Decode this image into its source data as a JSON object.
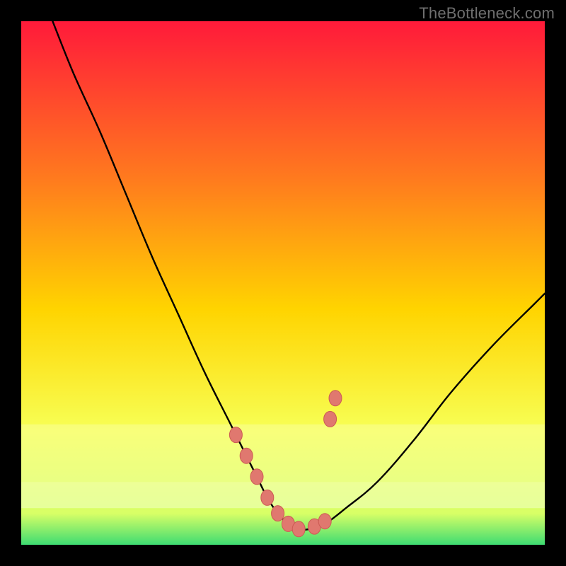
{
  "watermark": "TheBottleneck.com",
  "colors": {
    "bg_black": "#000000",
    "grad_top": "#ff1a3a",
    "grad_mid1": "#ff7a1e",
    "grad_mid2": "#ffd400",
    "grad_mid3": "#f7ff55",
    "grad_mid4": "#d8ff66",
    "grad_bottom": "#3edc72",
    "curve": "#000000",
    "marker_fill": "#e0786f",
    "marker_stroke": "#cc5b54",
    "watermark": "#6f6f6f"
  },
  "chart_data": {
    "type": "line",
    "title": "",
    "xlabel": "",
    "ylabel": "",
    "xlim": [
      0,
      100
    ],
    "ylim": [
      0,
      100
    ],
    "series": [
      {
        "name": "bottleneck-curve",
        "x": [
          6,
          10,
          15,
          20,
          25,
          30,
          35,
          40,
          45,
          47,
          49,
          51,
          53,
          55,
          58,
          62,
          68,
          75,
          82,
          90,
          98,
          100
        ],
        "y": [
          100,
          90,
          79,
          67,
          55,
          44,
          33,
          23,
          13,
          9,
          6,
          4,
          3,
          3,
          4,
          7,
          12,
          20,
          29,
          38,
          46,
          48
        ]
      }
    ],
    "markers": {
      "name": "highlight-points",
      "x": [
        41,
        43,
        45,
        47,
        49,
        51,
        53,
        56,
        58,
        59,
        60
      ],
      "y": [
        21,
        17,
        13,
        9,
        6,
        4,
        3,
        3.5,
        4.5,
        24,
        28
      ]
    },
    "band": {
      "name": "highlight-band",
      "y_top": 23,
      "y_mid_from": 12,
      "y_mid_to": 7
    }
  }
}
